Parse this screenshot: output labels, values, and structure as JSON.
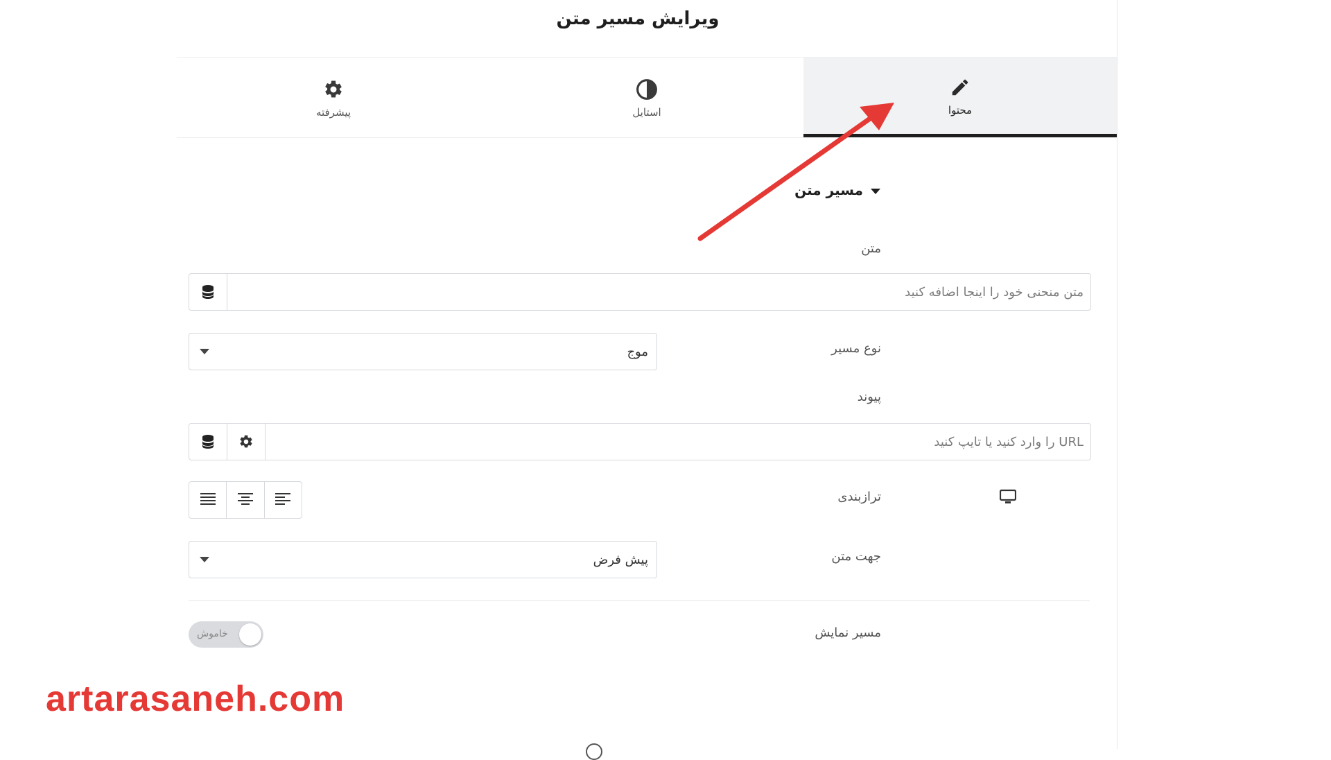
{
  "header": {
    "title": "ویرایش مسیر متن"
  },
  "tabs": [
    {
      "label": "محتوا",
      "icon": "pencil-icon",
      "active": true
    },
    {
      "label": "استایل",
      "icon": "contrast-icon",
      "active": false
    },
    {
      "label": "پیشرفته",
      "icon": "gear-icon",
      "active": false
    }
  ],
  "section": {
    "title": "مسیر متن"
  },
  "text_field": {
    "label": "متن",
    "placeholder": "متن منحنی خود را اینجا اضافه کنید"
  },
  "path_type": {
    "label": "نوع مسیر",
    "value": "موج"
  },
  "link": {
    "label": "پیوند",
    "placeholder": "URL را وارد کنید یا تایپ کنید"
  },
  "alignment": {
    "label": "ترازبندی"
  },
  "text_direction": {
    "label": "جهت متن",
    "value": "پیش فرض"
  },
  "show_path": {
    "label": "مسیر نمایش",
    "toggle_text": "خاموش",
    "on": false
  },
  "watermark": {
    "text": "artarasaneh.com"
  },
  "colors": {
    "accent": "#1e1e1e",
    "annotation": "#e53935",
    "border": "#d5d8dc"
  }
}
